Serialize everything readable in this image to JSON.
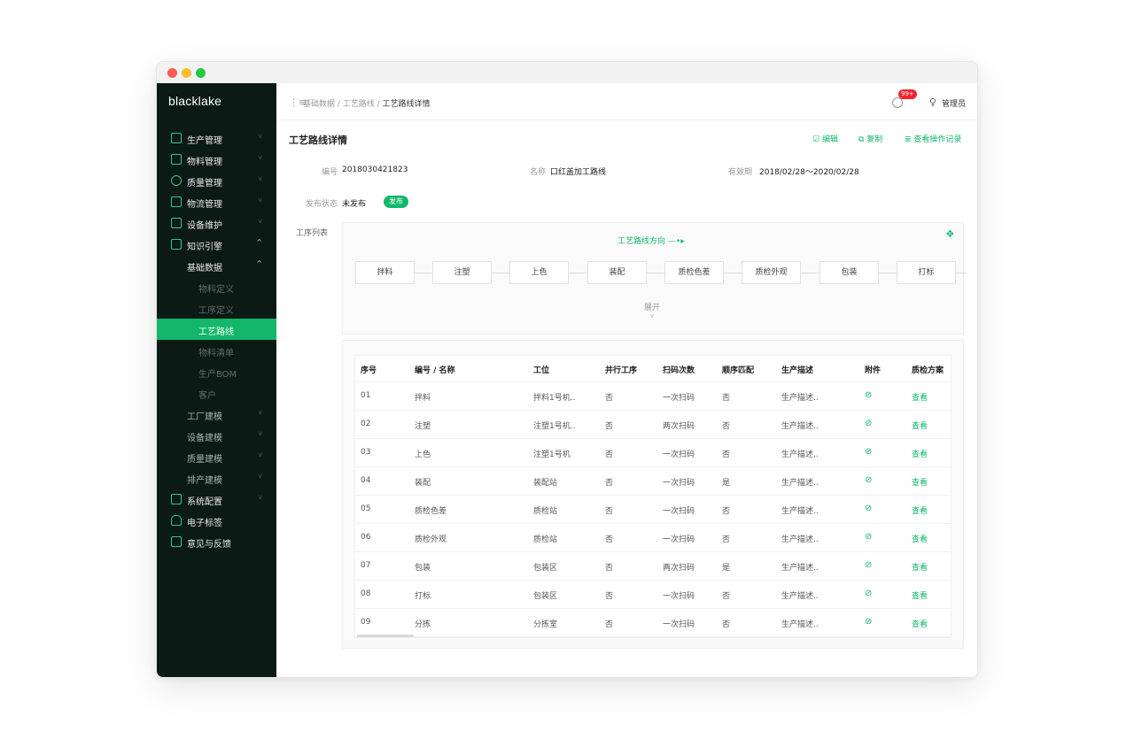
{
  "window_controls": {
    "close": "close",
    "minimize": "minimize",
    "maximize": "maximize"
  },
  "sidebar": {
    "logo": "blacklake",
    "items": [
      {
        "label": "生产管理",
        "chevron": "v"
      },
      {
        "label": "物料管理",
        "chevron": "v"
      },
      {
        "label": "质量管理",
        "chevron": "v"
      },
      {
        "label": "物流管理",
        "chevron": "v"
      },
      {
        "label": "设备维护",
        "chevron": "v"
      },
      {
        "label": "知识引擎",
        "chevron": "^"
      },
      {
        "label": "基础数据",
        "chevron": "^"
      },
      {
        "label": "物料定义"
      },
      {
        "label": "工序定义"
      },
      {
        "label": "工艺路线"
      },
      {
        "label": "物料清单"
      },
      {
        "label": "生产BOM"
      },
      {
        "label": "客户"
      },
      {
        "label": "工厂建模",
        "chevron": "v"
      },
      {
        "label": "设备建模",
        "chevron": "v"
      },
      {
        "label": "质量建模",
        "chevron": "v"
      },
      {
        "label": "排产建模",
        "chevron": "v"
      },
      {
        "label": "系统配置",
        "chevron": "v"
      },
      {
        "label": "电子标签"
      },
      {
        "label": "意见与反馈"
      }
    ]
  },
  "topbar": {
    "menu_icon": "⋮≡",
    "breadcrumb_1": "基础数据 / 工艺路线 /",
    "breadcrumb_current": "工艺路线详情",
    "notification_badge": "99+",
    "user_name": "管理员"
  },
  "page": {
    "title": "工艺路线详情",
    "edit_label": "编辑",
    "copy_label": "复制",
    "history_label": "查看操作记录"
  },
  "fields": {
    "code_label": "编号",
    "code_value": "2018030421823",
    "name_label": "名称",
    "name_value": "口红盖加工路线",
    "valid_label": "有效期",
    "valid_value": "2018/02/28～2020/02/28",
    "status_label": "发布状态",
    "status_value": "未发布",
    "publish_button": "发布",
    "process_list_label": "工序列表"
  },
  "flow": {
    "direction_label": "工艺路线方向",
    "direction_arrow": "—•▸",
    "steps": [
      "拌料",
      "注塑",
      "上色",
      "装配",
      "质检色差",
      "质检外观",
      "包装",
      "打标"
    ],
    "expand_label": "展开"
  },
  "table": {
    "headers": [
      "序号",
      "编号 / 名称",
      "工位",
      "并行工序",
      "扫码次数",
      "顺序匹配",
      "生产描述",
      "附件",
      "质检方案"
    ],
    "rows": [
      [
        "01",
        "拌料",
        "拌料1号机..",
        "否",
        "一次扫码",
        "否",
        "生产描述..",
        "⊘",
        "查看"
      ],
      [
        "02",
        "注塑",
        "注塑1号机..",
        "否",
        "两次扫码",
        "否",
        "生产描述..",
        "⊘",
        "查看"
      ],
      [
        "03",
        "上色",
        "注塑1号机",
        "否",
        "一次扫码",
        "否",
        "生产描述..",
        "⊘",
        "查看"
      ],
      [
        "04",
        "装配",
        "装配站",
        "否",
        "一次扫码",
        "是",
        "生产描述..",
        "⊘",
        "查看"
      ],
      [
        "05",
        "质检色差",
        "质检站",
        "否",
        "一次扫码",
        "否",
        "生产描述..",
        "⊘",
        "查看"
      ],
      [
        "06",
        "质检外观",
        "质检站",
        "否",
        "一次扫码",
        "否",
        "生产描述..",
        "⊘",
        "查看"
      ],
      [
        "07",
        "包装",
        "包装区",
        "否",
        "两次扫码",
        "是",
        "生产描述..",
        "⊘",
        "查看"
      ],
      [
        "08",
        "打标",
        "包装区",
        "否",
        "一次扫码",
        "否",
        "生产描述..",
        "⊘",
        "查看"
      ],
      [
        "09",
        "分拣",
        "分拣室",
        "否",
        "一次扫码",
        "否",
        "生产描述..",
        "⊘",
        "查看"
      ]
    ]
  },
  "colors": {
    "accent": "#12b76a",
    "sidebar_bg": "#0b1a14",
    "badge": "#f5222d"
  }
}
